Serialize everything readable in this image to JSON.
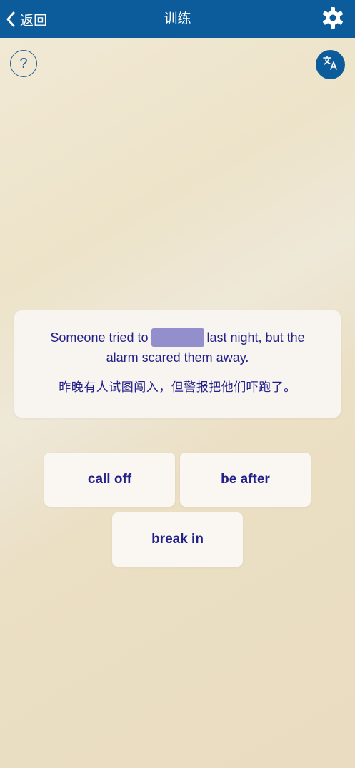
{
  "header": {
    "back_label": "返回",
    "title": "训练",
    "settings_icon": "gear-icon",
    "background_color": "#0c5c9c"
  },
  "toolbar": {
    "help_label": "?",
    "translate_icon": "translate-icon"
  },
  "exercise": {
    "sentence_before": "Someone tried to",
    "sentence_after": "last night, but the alarm scared them away.",
    "translation": "昨晚有人试图闯入，但警报把他们吓跑了。",
    "blank_color": "#928fcc",
    "text_color": "#24208a"
  },
  "options": [
    {
      "label": "call off"
    },
    {
      "label": "be after"
    },
    {
      "label": "break in"
    }
  ]
}
